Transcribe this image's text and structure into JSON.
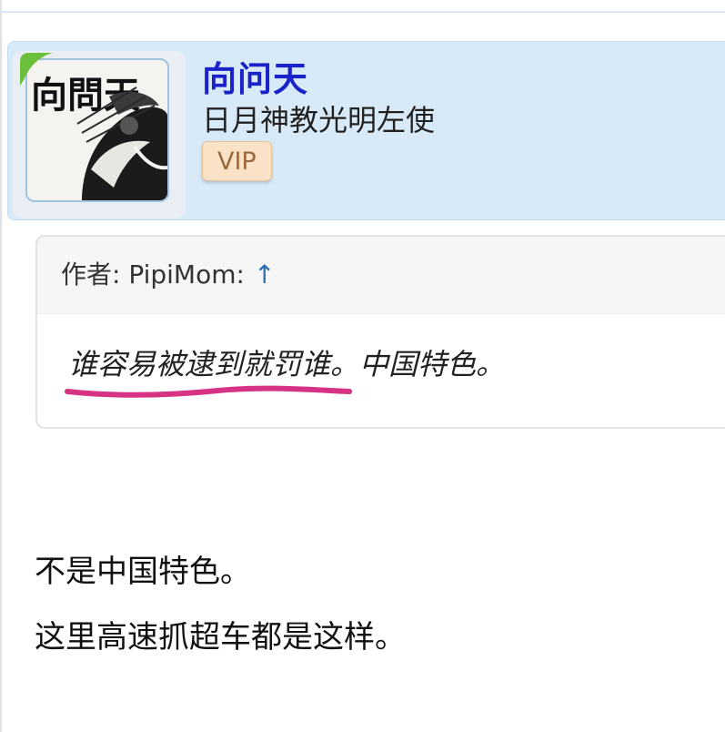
{
  "user": {
    "name": "向问天",
    "title": "日月神教光明左使",
    "badge": "VIP",
    "avatar_alt": "向問天"
  },
  "quote": {
    "author_label": "作者: PipiMom:",
    "arrow": "↑",
    "text": "谁容易被逮到就罚谁。中国特色。"
  },
  "reply": {
    "lines": [
      "不是中国特色。",
      "这里高速抓超车都是这样。"
    ]
  },
  "colors": {
    "username": "#1a23c8",
    "card_bg": "#d8eaf8",
    "vip_bg": "#fbe1c6",
    "underline": "#d63384",
    "arrow": "#2a6fb3"
  }
}
